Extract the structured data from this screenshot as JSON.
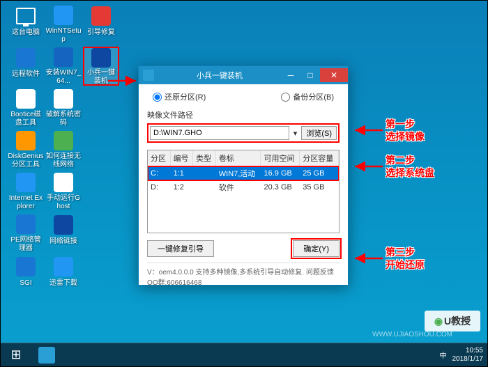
{
  "desktop_icons": [
    [
      {
        "name": "this-pc",
        "label": "这台电脑",
        "bg": "transparent"
      },
      {
        "name": "winntsetup",
        "label": "WinNTSetup",
        "bg": "#2196f3"
      },
      {
        "name": "boot-repair",
        "label": "引导修复",
        "bg": "#e53935"
      }
    ],
    [
      {
        "name": "remote-soft",
        "label": "远程软件",
        "bg": "#1976d2"
      },
      {
        "name": "install",
        "label": "安装WIN7_64...",
        "bg": "#1565c0"
      },
      {
        "name": "xiaobing",
        "label": "小兵一键装机",
        "bg": "#0d47a1",
        "highlighted": true
      }
    ],
    [
      {
        "name": "bootice",
        "label": "Bootice磁盘工具",
        "bg": "#fff"
      },
      {
        "name": "crack-pwd",
        "label": "破解系统密码",
        "bg": "#fff"
      }
    ],
    [
      {
        "name": "diskgenius",
        "label": "DiskGenius分区工具",
        "bg": "#ff9800"
      },
      {
        "name": "wifi-connect",
        "label": "如何连接无线网络",
        "bg": "#4caf50"
      }
    ],
    [
      {
        "name": "ie",
        "label": "Internet Explorer",
        "bg": "#2196f3"
      },
      {
        "name": "ghost",
        "label": "手动运行Ghost",
        "bg": "#fff"
      }
    ],
    [
      {
        "name": "pe-net",
        "label": "PE网络管理器",
        "bg": "#1976d2"
      },
      {
        "name": "net-link",
        "label": "网络链接",
        "bg": "#0d47a1"
      }
    ],
    [
      {
        "name": "sgi",
        "label": "SGI",
        "bg": "#1976d2"
      },
      {
        "name": "xunlei",
        "label": "迅雷下载",
        "bg": "#2196f3"
      }
    ]
  ],
  "dialog": {
    "title": "小兵一键装机",
    "radio_restore": "还原分区(R)",
    "radio_backup": "备份分区(B)",
    "path_label": "映像文件路径",
    "path_value": "D:\\WIN7.GHO",
    "browse_btn": "浏览(S)",
    "columns": [
      "分区",
      "编号",
      "类型",
      "卷标",
      "可用空间",
      "分区容量"
    ],
    "rows": [
      {
        "part": "C:",
        "num": "1:1",
        "type": "",
        "label": "WIN7,活动",
        "free": "16.9 GB",
        "size": "25 GB",
        "selected": true
      },
      {
        "part": "D:",
        "num": "1:2",
        "type": "",
        "label": "软件",
        "free": "20.3 GB",
        "size": "35 GB",
        "selected": false
      }
    ],
    "repair_btn": "一键修复引导",
    "ok_btn": "确定(Y)",
    "footer": "V：oem4.0.0.0        支持多种镜像,多系统引导自动修复. 问题反馈QQ群:606616468"
  },
  "annotations": {
    "step1": {
      "title": "第一步",
      "desc": "选择镜像"
    },
    "step2": {
      "title": "第二步",
      "desc": "选择系统盘"
    },
    "step3": {
      "title": "第三步",
      "desc": "开始还原"
    }
  },
  "taskbar": {
    "time": "10:55",
    "date": "2018/1/17",
    "ime": "中"
  },
  "watermark": "WWW.UJIAOSHOU.COM",
  "logo": "U教授"
}
